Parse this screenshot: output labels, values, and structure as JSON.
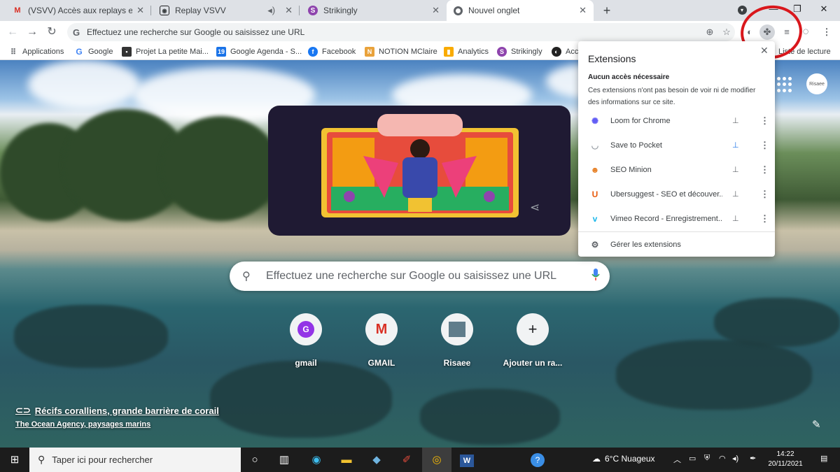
{
  "browser": {
    "tabs": [
      {
        "title": "(VSVV) Accès aux replays et dans",
        "favicon": "gmail-icon",
        "active": false
      },
      {
        "title": "Replay VSVV",
        "favicon": "video-icon",
        "active": false,
        "muted_icon": "speaker-icon"
      },
      {
        "title": "Strikingly",
        "favicon": "strikingly-icon",
        "active": false
      },
      {
        "title": "Nouvel onglet",
        "favicon": "chrome-icon",
        "active": true
      }
    ],
    "new_tab_symbol": "+",
    "omnibox_placeholder": "Effectuez une recherche sur Google ou saisissez une URL",
    "bookmarks": [
      {
        "label": "Applications",
        "icon": "apps-grid-icon"
      },
      {
        "label": "Google",
        "icon": "google-icon"
      },
      {
        "label": "Projet La petite Mai...",
        "icon": "project-icon"
      },
      {
        "label": "Google Agenda - S...",
        "icon": "calendar-icon",
        "icon_text": "19"
      },
      {
        "label": "Facebook",
        "icon": "facebook-icon"
      },
      {
        "label": "NOTION MClaire",
        "icon": "notion-icon"
      },
      {
        "label": "Analytics",
        "icon": "analytics-icon"
      },
      {
        "label": "Strikingly",
        "icon": "strikingly-icon"
      },
      {
        "label": "Acc",
        "icon": "acc-icon"
      },
      {
        "label": "Liste de lecture",
        "icon": "reading-list-icon"
      }
    ]
  },
  "newtab": {
    "search_placeholder": "Effectuez une recherche sur Google ou saisissez une URL",
    "shortcuts": [
      {
        "label": "gmail",
        "icon_text": "G"
      },
      {
        "label": "GMAIL",
        "icon_text": "M"
      },
      {
        "label": "Risaee",
        "icon_text": ""
      },
      {
        "label": "Ajouter un ra...",
        "icon_text": "+"
      }
    ],
    "attribution_title": "Récifs coralliens, grande barrière de corail",
    "attribution_credit": "The Ocean Agency, paysages marins",
    "profile_text": "Risaee"
  },
  "extensions_popup": {
    "title": "Extensions",
    "section_title": "Aucun accès nécessaire",
    "section_desc": "Ces extensions n'ont pas besoin de voir ni de modifier des informations sur ce site.",
    "items": [
      {
        "name": "Loom for Chrome",
        "icon": "loom-icon",
        "pinned": false
      },
      {
        "name": "Save to Pocket",
        "icon": "pocket-icon",
        "pinned": true
      },
      {
        "name": "SEO Minion",
        "icon": "seo-minion-icon",
        "pinned": false
      },
      {
        "name": "Ubersuggest - SEO et découver...",
        "icon": "ubersuggest-icon",
        "pinned": false
      },
      {
        "name": "Vimeo Record - Enregistrement...",
        "icon": "vimeo-icon",
        "pinned": false
      }
    ],
    "manage_label": "Gérer les extensions"
  },
  "taskbar": {
    "search_placeholder": "Taper ici pour rechercher",
    "weather": "6°C  Nuageux",
    "time": "14:22",
    "date": "20/11/2021"
  },
  "colors": {
    "highlight_ring": "#d9171c",
    "pin_active": "#1a73e8",
    "chrome_tab_strip": "#dee1e6"
  }
}
